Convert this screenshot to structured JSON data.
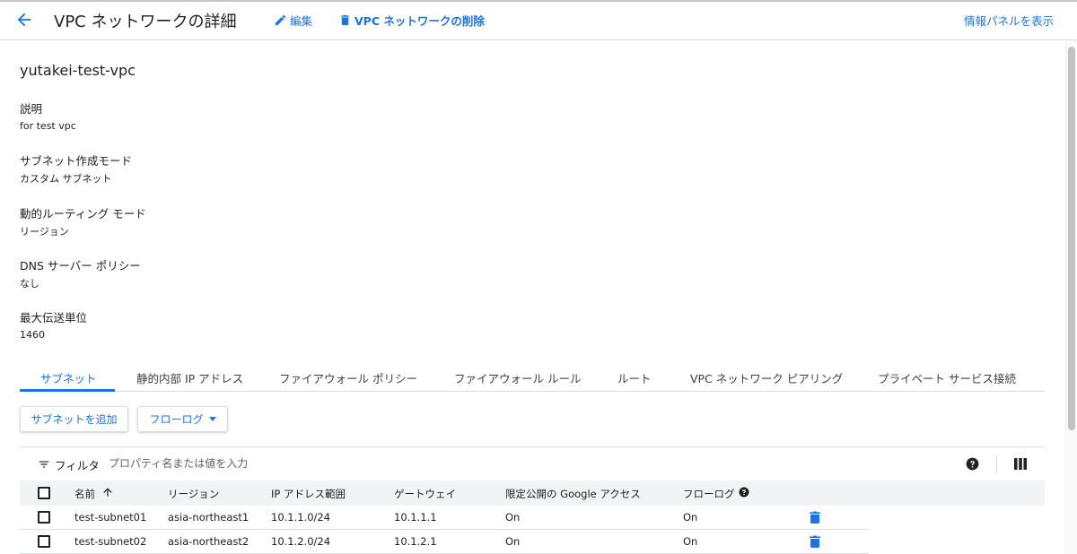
{
  "header": {
    "title": "VPC ネットワークの詳細",
    "edit_label": "編集",
    "delete_label": "VPC ネットワークの削除",
    "info_panel_label": "情報パネルを表示"
  },
  "network": {
    "name": "yutakei-test-vpc",
    "fields": [
      {
        "label": "説明",
        "value": "for test vpc"
      },
      {
        "label": "サブネット作成モード",
        "value": "カスタム サブネット"
      },
      {
        "label": "動的ルーティング モード",
        "value": "リージョン"
      },
      {
        "label": "DNS サーバー ポリシー",
        "value": "なし"
      },
      {
        "label": "最大伝送単位",
        "value": "1460"
      }
    ]
  },
  "tabs": [
    {
      "label": "サブネット",
      "active": true
    },
    {
      "label": "静的内部 IP アドレス",
      "active": false
    },
    {
      "label": "ファイアウォール ポリシー",
      "active": false
    },
    {
      "label": "ファイアウォール ルール",
      "active": false
    },
    {
      "label": "ルート",
      "active": false
    },
    {
      "label": "VPC ネットワーク ピアリング",
      "active": false
    },
    {
      "label": "プライベート サービス接続",
      "active": false
    }
  ],
  "actions": {
    "add_subnet": "サブネットを追加",
    "flow_logs": "フローログ"
  },
  "filter": {
    "label": "フィルタ",
    "placeholder": "プロパティ名または値を入力"
  },
  "table": {
    "columns": [
      "名前",
      "リージョン",
      "IP アドレス範囲",
      "ゲートウェイ",
      "限定公開の Google アクセス",
      "フローログ"
    ],
    "rows": [
      {
        "name": "test-subnet01",
        "region": "asia-northeast1",
        "ip_range": "10.1.1.0/24",
        "gateway": "10.1.1.1",
        "private_google_access": "On",
        "flow_logs": "On"
      },
      {
        "name": "test-subnet02",
        "region": "asia-northeast2",
        "ip_range": "10.1.2.0/24",
        "gateway": "10.1.2.1",
        "private_google_access": "On",
        "flow_logs": "On"
      }
    ]
  },
  "colors": {
    "accent": "#1a73e8",
    "text": "#202124",
    "border": "#dadce0",
    "table_header_bg": "#f1f3f4"
  }
}
